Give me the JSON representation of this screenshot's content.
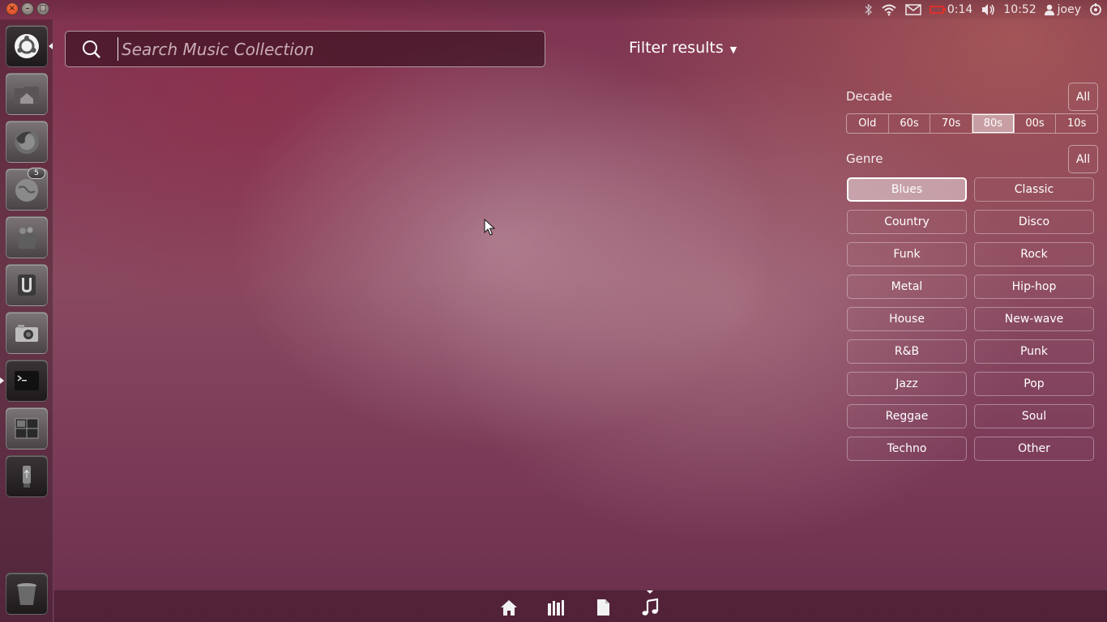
{
  "top_panel": {
    "battery_time": "0:14",
    "clock": "10:52",
    "user": "joey",
    "icons": [
      "bluetooth-icon",
      "wifi-icon",
      "mail-icon",
      "battery-icon",
      "volume-icon",
      "user-icon",
      "session-icon"
    ]
  },
  "window_controls": [
    "close-icon",
    "minimize-icon",
    "maximize-icon"
  ],
  "launcher": {
    "items": [
      {
        "name": "dash-home",
        "icon": "ubuntu-logo-icon"
      },
      {
        "name": "home-folder",
        "icon": "folder-home-icon"
      },
      {
        "name": "firefox",
        "icon": "firefox-icon"
      },
      {
        "name": "empathy",
        "icon": "chat-globe-icon",
        "badge": "5"
      },
      {
        "name": "software-center",
        "icon": "shopping-bag-icon"
      },
      {
        "name": "ubuntu-one",
        "icon": "ubuntu-one-icon"
      },
      {
        "name": "cheese",
        "icon": "camera-icon"
      },
      {
        "name": "terminal",
        "icon": "terminal-icon"
      },
      {
        "name": "workspaces",
        "icon": "workspace-switcher-icon"
      },
      {
        "name": "usb-drive",
        "icon": "usb-drive-icon"
      },
      {
        "name": "trash",
        "icon": "trash-icon"
      }
    ]
  },
  "search": {
    "placeholder": "Search Music Collection",
    "value": ""
  },
  "filter_results": {
    "label": "Filter results"
  },
  "filters": {
    "decade": {
      "title": "Decade",
      "all_label": "All",
      "options": [
        "Old",
        "60s",
        "70s",
        "80s",
        "00s",
        "10s"
      ],
      "selected": "80s"
    },
    "genre": {
      "title": "Genre",
      "all_label": "All",
      "options": [
        "Blues",
        "Classic",
        "Country",
        "Disco",
        "Funk",
        "Rock",
        "Metal",
        "Hip-hop",
        "House",
        "New-wave",
        "R&B",
        "Punk",
        "Jazz",
        "Pop",
        "Reggae",
        "Soul",
        "Techno",
        "Other"
      ],
      "selected": "Blues"
    }
  },
  "lens_bar": {
    "lenses": [
      "home-lens-icon",
      "applications-lens-icon",
      "files-lens-icon",
      "music-lens-icon"
    ],
    "active": "music-lens-icon"
  },
  "colors": {
    "accent_red": "#e0302a",
    "close_button": "#e8501f"
  }
}
